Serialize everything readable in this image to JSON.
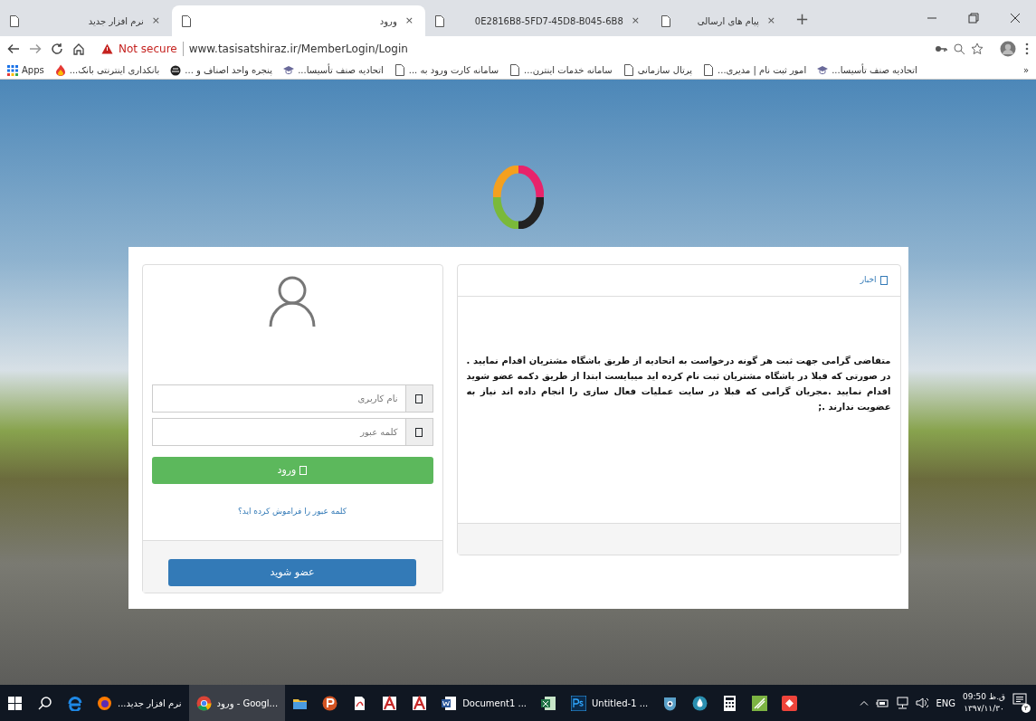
{
  "browser": {
    "tabs": [
      {
        "title": "پیام های ارسالی",
        "close": "×",
        "selected": false
      },
      {
        "title": "0E2816B8-5FD7-45D8-B045-6B8",
        "close": "×",
        "selected": false
      },
      {
        "title": "ورود",
        "close": "×",
        "selected": true
      },
      {
        "title": "نرم افزار جدید",
        "close": "×",
        "selected": false
      }
    ],
    "new_tab": "+",
    "address_bar": {
      "security": "Not secure",
      "url": "www.tasisatshiraz.ir/MemberLogin/Login"
    },
    "bookmarks": [
      {
        "label": "اتحادیه صنف تأسیسا...",
        "kind": "cap"
      },
      {
        "label": "امور ثبت نام | مدیری...",
        "kind": "page"
      },
      {
        "label": "پرتال سازمانی",
        "kind": "page"
      },
      {
        "label": "سامانه خدمات اینترن...",
        "kind": "page"
      },
      {
        "label": "سامانه کارت ورود به ...",
        "kind": "page"
      },
      {
        "label": "اتحادیه صنف تأسیسا...",
        "kind": "cap"
      },
      {
        "label": "پنجره واحد اصناف و ...",
        "kind": "globe"
      },
      {
        "label": "بانکداری اینترنتی بانک...",
        "kind": "flame"
      },
      {
        "label": "Apps",
        "kind": "apps"
      }
    ],
    "more_bookmarks": "»"
  },
  "login": {
    "username": {
      "placeholder": "نام کاربری"
    },
    "password": {
      "placeholder": "کلمه عبور"
    },
    "login_button": "ورود",
    "forgot_link": "کلمه عبور را فراموش کرده اید؟",
    "register_button": "عضو شوید"
  },
  "news": {
    "title": "اخبار",
    "body": "متقاضی گرامی جهت ثبت هر گونه درخواست به اتحادیه از طریق باشگاه مشتریان اقدام نمایید . در صورتی که قبلا در باشگاه مشتریان ثبت نام کرده اید میبایست ابتدا از طریق دکمه عضو شوید اقدام نمایید .مجریان گرامی که قبلا در سایت عملیات فعال سازی را انجام داده اند نیاز به عضویت ندارند .;"
  },
  "taskbar": {
    "items": [
      {
        "kind": "anydesk",
        "selected": false
      },
      {
        "kind": "green",
        "selected": false
      },
      {
        "kind": "calc",
        "selected": false
      },
      {
        "kind": "drop",
        "selected": false
      },
      {
        "kind": "eye",
        "selected": false
      },
      {
        "kind": "ps",
        "label": "Untitled-1 ...",
        "selected": false
      },
      {
        "kind": "excel",
        "selected": false
      },
      {
        "kind": "word",
        "label": "Document1 ...",
        "selected": false
      },
      {
        "kind": "cad",
        "selected": false
      },
      {
        "kind": "cad",
        "selected": false
      },
      {
        "kind": "pdf",
        "selected": false
      },
      {
        "kind": "p-app",
        "selected": false
      },
      {
        "kind": "folder",
        "selected": false
      },
      {
        "kind": "chrome",
        "label": "ورود - Googl...",
        "selected": true
      },
      {
        "kind": "firefox",
        "label": "...نرم افزار جدید",
        "selected": false
      },
      {
        "kind": "edge",
        "selected": false
      },
      {
        "kind": "search",
        "selected": false
      },
      {
        "kind": "start",
        "selected": false
      }
    ],
    "language": "ENG",
    "time": "09:50 ق.ظ",
    "date": "۱۳۹۷/۱۱/۳۰",
    "notification_count": "۳"
  }
}
